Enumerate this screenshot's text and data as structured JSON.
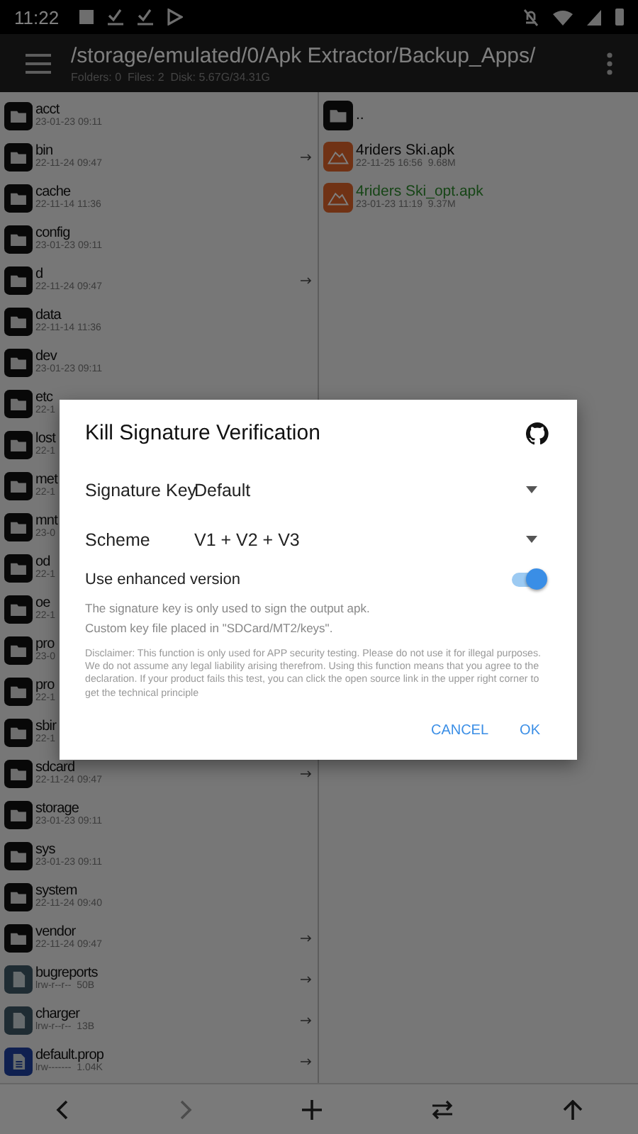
{
  "status_bar": {
    "time": "11:22"
  },
  "toolbar": {
    "path": "/storage/emulated/0/Apk Extractor/Backup_Apps/",
    "summary": "Folders: 0  Files: 2  Disk: 5.67G/34.31G"
  },
  "left_pane": {
    "items": [
      {
        "kind": "folder",
        "name": "acct",
        "meta": "23-01-23 09:11",
        "link": false
      },
      {
        "kind": "folder",
        "name": "bin",
        "meta": "22-11-24 09:47",
        "link": true
      },
      {
        "kind": "folder",
        "name": "cache",
        "meta": "22-11-14 11:36",
        "link": false
      },
      {
        "kind": "folder",
        "name": "config",
        "meta": "23-01-23 09:11",
        "link": false
      },
      {
        "kind": "folder",
        "name": "d",
        "meta": "22-11-24 09:47",
        "link": true
      },
      {
        "kind": "folder",
        "name": "data",
        "meta": "22-11-14 11:36",
        "link": false
      },
      {
        "kind": "folder",
        "name": "dev",
        "meta": "23-01-23 09:11",
        "link": false
      },
      {
        "kind": "folder",
        "name": "etc",
        "meta": "22-1"
      },
      {
        "kind": "folder",
        "name": "lost",
        "meta": "22-1"
      },
      {
        "kind": "folder",
        "name": "met",
        "meta": "22-1"
      },
      {
        "kind": "folder",
        "name": "mnt",
        "meta": "23-0"
      },
      {
        "kind": "folder",
        "name": "od",
        "meta": "22-1"
      },
      {
        "kind": "folder",
        "name": "oe",
        "meta": "22-1"
      },
      {
        "kind": "folder",
        "name": "pro",
        "meta": "23-0"
      },
      {
        "kind": "folder",
        "name": "pro",
        "meta": "22-1"
      },
      {
        "kind": "folder",
        "name": "sbir",
        "meta": "22-1"
      },
      {
        "kind": "folder",
        "name": "sdcard",
        "meta": "22-11-24 09:47",
        "link": true
      },
      {
        "kind": "folder",
        "name": "storage",
        "meta": "23-01-23 09:11",
        "link": false
      },
      {
        "kind": "folder",
        "name": "sys",
        "meta": "23-01-23 09:11",
        "link": false
      },
      {
        "kind": "folder",
        "name": "system",
        "meta": "22-11-24 09:40",
        "link": false
      },
      {
        "kind": "folder",
        "name": "vendor",
        "meta": "22-11-24 09:47",
        "link": true
      },
      {
        "kind": "file",
        "name": "bugreports",
        "meta": "lrw-r--r--  50B",
        "link": true
      },
      {
        "kind": "file",
        "name": "charger",
        "meta": "lrw-r--r--  13B",
        "link": true
      },
      {
        "kind": "prop",
        "name": "default.prop",
        "meta": "lrw-------  1.04K",
        "link": true
      }
    ]
  },
  "right_pane": {
    "items": [
      {
        "kind": "folder",
        "name": "..",
        "highlight": false
      },
      {
        "kind": "apk",
        "name": "4riders Ski.apk",
        "meta": "22-11-25 16:56  9.68M",
        "highlight": false
      },
      {
        "kind": "apk",
        "name": "4riders Ski_opt.apk",
        "meta": "23-01-23 11:19  9.37M",
        "highlight": true
      }
    ]
  },
  "dialog": {
    "title": "Kill Signature Verification",
    "fields": [
      {
        "label": "Signature Key",
        "value": "Default"
      },
      {
        "label": "Scheme",
        "value": "V1 + V2 + V3"
      }
    ],
    "toggle": {
      "label": "Use enhanced version",
      "on": true
    },
    "notes": [
      "The signature key is only used to sign the output apk.",
      "Custom key file placed in \"SDCard/MT2/keys\"."
    ],
    "disclaimer": "Disclaimer: This function is only used for APP security testing. Please do not use it for illegal purposes. We do not assume any legal liability arising therefrom. Using this function means that you agree to the declaration. If your product fails this test, you can click the open source link in the upper right corner to get the technical principle",
    "buttons": [
      "CANCEL",
      "OK"
    ]
  }
}
